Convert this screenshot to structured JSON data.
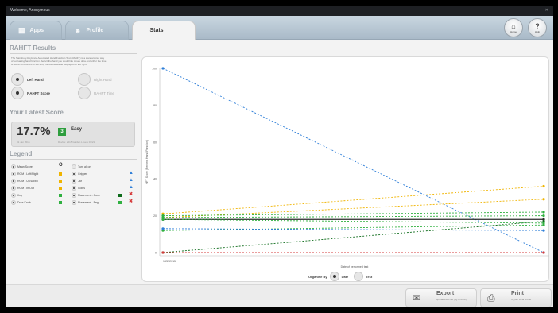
{
  "window": {
    "title": "Welcome, Anonymous",
    "controls": "— ✕"
  },
  "tabs": [
    {
      "label": "Apps",
      "icon": "apps-icon"
    },
    {
      "label": "Profile",
      "icon": "profile-icon"
    },
    {
      "label": "Stats",
      "icon": "stats-icon"
    }
  ],
  "topbar": {
    "home_label": "Home",
    "help_label": "Help"
  },
  "rahft": {
    "title": "RAHFT Results",
    "description": "The Sainsbury-Roylance Automated Hand Function Test (RAHFT) is a standardized way of evaluating hand function. Select the hand you would like to see data and either the time or score component of the test, the results will be displayed on the right.",
    "options": {
      "left_hand": "Left Hand",
      "right_hand": "Right Hand",
      "rahft_score": "RAHFT Score",
      "rahft_time": "RAHFT Time"
    }
  },
  "latest_score": {
    "title": "Your Latest Score",
    "value": "17.7%",
    "badge": "3",
    "level": "Easy",
    "date": "01 Jan 2015",
    "device": "Device: 2015 Garden Levels 01/21"
  },
  "legend": {
    "title": "Legend",
    "items_col1": [
      {
        "label": "Mean Score"
      },
      {
        "label": "ROM - Left/Right"
      },
      {
        "label": "ROM - Up/Down"
      },
      {
        "label": "ROM - In/Out"
      },
      {
        "label": "Key"
      },
      {
        "label": "Door Knob"
      }
    ],
    "items_col2": [
      {
        "label": "Turn all on"
      },
      {
        "label": "Gripper"
      },
      {
        "label": "Jar"
      },
      {
        "label": "Coins"
      },
      {
        "label": "Placement - Cone"
      },
      {
        "label": "Placement - Peg"
      }
    ]
  },
  "chart_data": {
    "type": "line",
    "xlabel": "Date of performed test",
    "ylabel": "HFT Score (Percent Hand Function)",
    "x_tick": "1-22-2015",
    "ylim": [
      0,
      100
    ],
    "y_ticks": [
      0,
      20,
      40,
      60,
      80,
      100
    ],
    "grid": false,
    "series": [
      {
        "color": "#2f7fd8",
        "dash": "2,2",
        "values": [
          100,
          0
        ]
      },
      {
        "color": "#f0b400",
        "dash": "2,2",
        "values": [
          21,
          36
        ]
      },
      {
        "color": "#f0b400",
        "dash": "2,2",
        "values": [
          19,
          29
        ]
      },
      {
        "color": "#30b040",
        "dash": "2,2",
        "values": [
          20,
          22
        ]
      },
      {
        "color": "#30b040",
        "dash": "2,2",
        "values": [
          19,
          20
        ]
      },
      {
        "color": "#2a2a2a",
        "dash": "",
        "values": [
          18,
          18
        ]
      },
      {
        "color": "#30b040",
        "dash": "2,2",
        "values": [
          18,
          16
        ]
      },
      {
        "color": "#30b040",
        "dash": "2,2",
        "values": [
          12,
          15
        ]
      },
      {
        "color": "#2f7fd8",
        "dash": "2,2",
        "values": [
          13,
          12
        ]
      },
      {
        "color": "#0d6b1a",
        "dash": "2,2",
        "values": [
          0,
          17
        ]
      },
      {
        "color": "#d63b3b",
        "dash": "2,2",
        "values": [
          0,
          0
        ]
      }
    ]
  },
  "organise": {
    "label": "Organise By",
    "date": "Date",
    "test": "Test"
  },
  "export": {
    "title": "Export",
    "subtitle": "spreadsheet file (eg to excel)"
  },
  "print": {
    "title": "Print",
    "subtitle": "to your local printer"
  }
}
